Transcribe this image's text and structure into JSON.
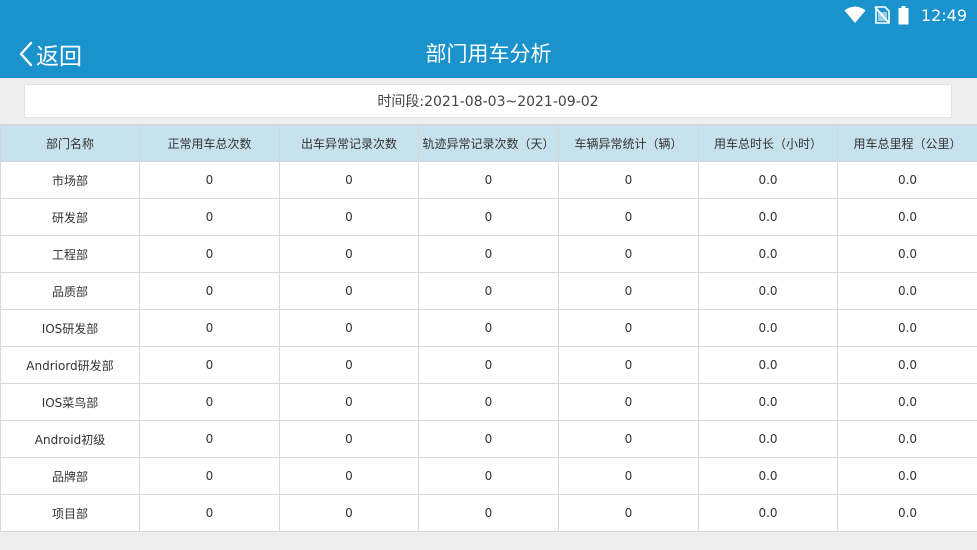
{
  "status": {
    "time": "12:49"
  },
  "appbar": {
    "back_label": "返回",
    "title": "部门用车分析"
  },
  "range": {
    "text": "时间段:2021-08-03~2021-09-02"
  },
  "table": {
    "headers": [
      "部门名称",
      "正常用车总次数",
      "出车异常记录次数",
      "轨迹异常记录次数（天）",
      "车辆异常统计（辆）",
      "用车总时长（小时）",
      "用车总里程（公里）"
    ],
    "rows": [
      [
        "市场部",
        "0",
        "0",
        "0",
        "0",
        "0.0",
        "0.0"
      ],
      [
        "研发部",
        "0",
        "0",
        "0",
        "0",
        "0.0",
        "0.0"
      ],
      [
        "工程部",
        "0",
        "0",
        "0",
        "0",
        "0.0",
        "0.0"
      ],
      [
        "品质部",
        "0",
        "0",
        "0",
        "0",
        "0.0",
        "0.0"
      ],
      [
        "IOS研发部",
        "0",
        "0",
        "0",
        "0",
        "0.0",
        "0.0"
      ],
      [
        "Andriord研发部",
        "0",
        "0",
        "0",
        "0",
        "0.0",
        "0.0"
      ],
      [
        "IOS菜鸟部",
        "0",
        "0",
        "0",
        "0",
        "0.0",
        "0.0"
      ],
      [
        "Android初级",
        "0",
        "0",
        "0",
        "0",
        "0.0",
        "0.0"
      ],
      [
        "品牌部",
        "0",
        "0",
        "0",
        "0",
        "0.0",
        "0.0"
      ],
      [
        "项目部",
        "0",
        "0",
        "0",
        "0",
        "0.0",
        "0.0"
      ]
    ]
  },
  "colors": {
    "primary": "#1a93cd",
    "header_bg": "#c7e2ec",
    "page_bg": "#eeeeee"
  },
  "icons": [
    "wifi-icon",
    "no-sim-icon",
    "battery-icon",
    "chevron-left-icon"
  ]
}
